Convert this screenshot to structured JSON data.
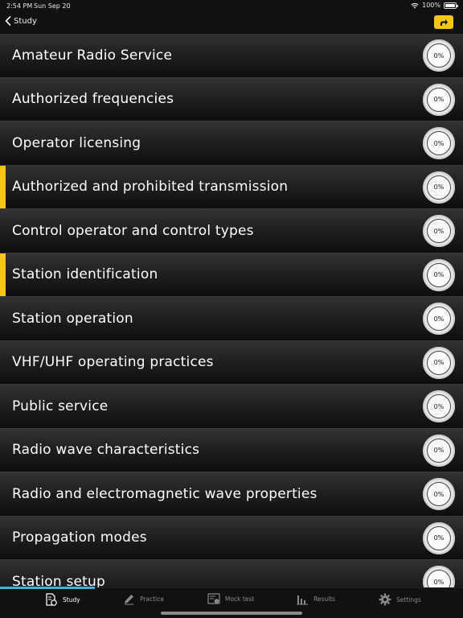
{
  "status": {
    "time": "2:54 PM",
    "date": "Sun Sep 20",
    "battery": "100%"
  },
  "nav": {
    "back_label": "Study",
    "share_icon": "share-arrow-icon",
    "accent_color": "#f5c518"
  },
  "topics": [
    {
      "label": "Amateur Radio Service",
      "progress": "0%",
      "marked": false
    },
    {
      "label": "Authorized frequencies",
      "progress": "0%",
      "marked": false
    },
    {
      "label": "Operator licensing",
      "progress": "0%",
      "marked": false
    },
    {
      "label": "Authorized and prohibited transmission",
      "progress": "0%",
      "marked": true
    },
    {
      "label": "Control operator and control types",
      "progress": "0%",
      "marked": false
    },
    {
      "label": "Station identification",
      "progress": "0%",
      "marked": true
    },
    {
      "label": "Station operation",
      "progress": "0%",
      "marked": false
    },
    {
      "label": "VHF/UHF operating practices",
      "progress": "0%",
      "marked": false
    },
    {
      "label": "Public service",
      "progress": "0%",
      "marked": false
    },
    {
      "label": "Radio wave characteristics",
      "progress": "0%",
      "marked": false
    },
    {
      "label": "Radio and electromagnetic wave properties",
      "progress": "0%",
      "marked": false
    },
    {
      "label": "Propagation modes",
      "progress": "0%",
      "marked": false
    },
    {
      "label": "Station setup",
      "progress": "0%",
      "marked": false
    }
  ],
  "tabs": [
    {
      "label": "Study",
      "icon": "study-doc-icon",
      "active": true
    },
    {
      "label": "Practice",
      "icon": "pencil-icon",
      "active": false
    },
    {
      "label": "Mock test",
      "icon": "mock-test-icon",
      "active": false
    },
    {
      "label": "Results",
      "icon": "bar-chart-icon",
      "active": false
    },
    {
      "label": "Settings",
      "icon": "gear-icon",
      "active": false
    }
  ],
  "colors": {
    "marker": "#f5c518",
    "tab_indicator": "#3fb0e0"
  }
}
